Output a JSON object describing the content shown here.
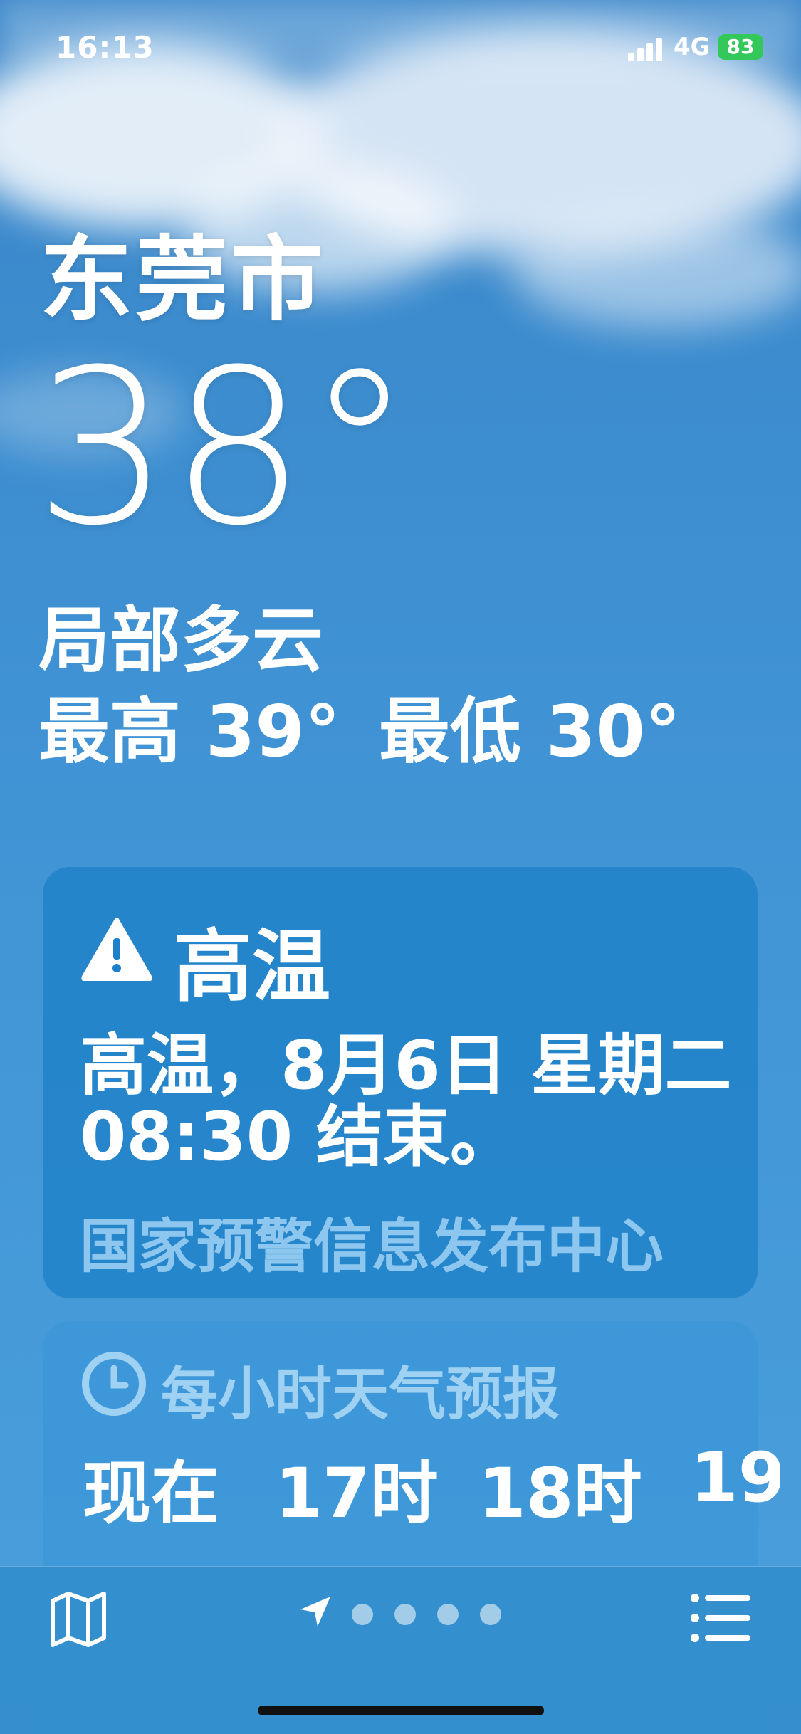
{
  "status_bar": {
    "time": "16:13",
    "network": "4G",
    "battery": "83"
  },
  "location": {
    "city": "东莞市",
    "temperature": "38°",
    "condition": "局部多云",
    "high": "最高 39°",
    "low": "最低 30°"
  },
  "alert": {
    "icon": "warning-icon",
    "title": "高温",
    "body_line1": "高温，8月6日 星期二",
    "body_line2": "08:30 结束。",
    "source": "国家预警信息发布中心"
  },
  "hourly": {
    "icon": "clock-icon",
    "title": "每小时天气预报",
    "hours": [
      "现在",
      "17时",
      "18时",
      "19"
    ]
  },
  "bottom_bar": {
    "map_icon": "map-icon",
    "location_icon": "location-arrow-icon",
    "page_dots": 4,
    "list_icon": "list-icon"
  },
  "colors": {
    "battery": "#34c759",
    "sky": "#3d8fd1",
    "alert_card": "#1d80c8",
    "source_text": "#a0d2f5"
  }
}
